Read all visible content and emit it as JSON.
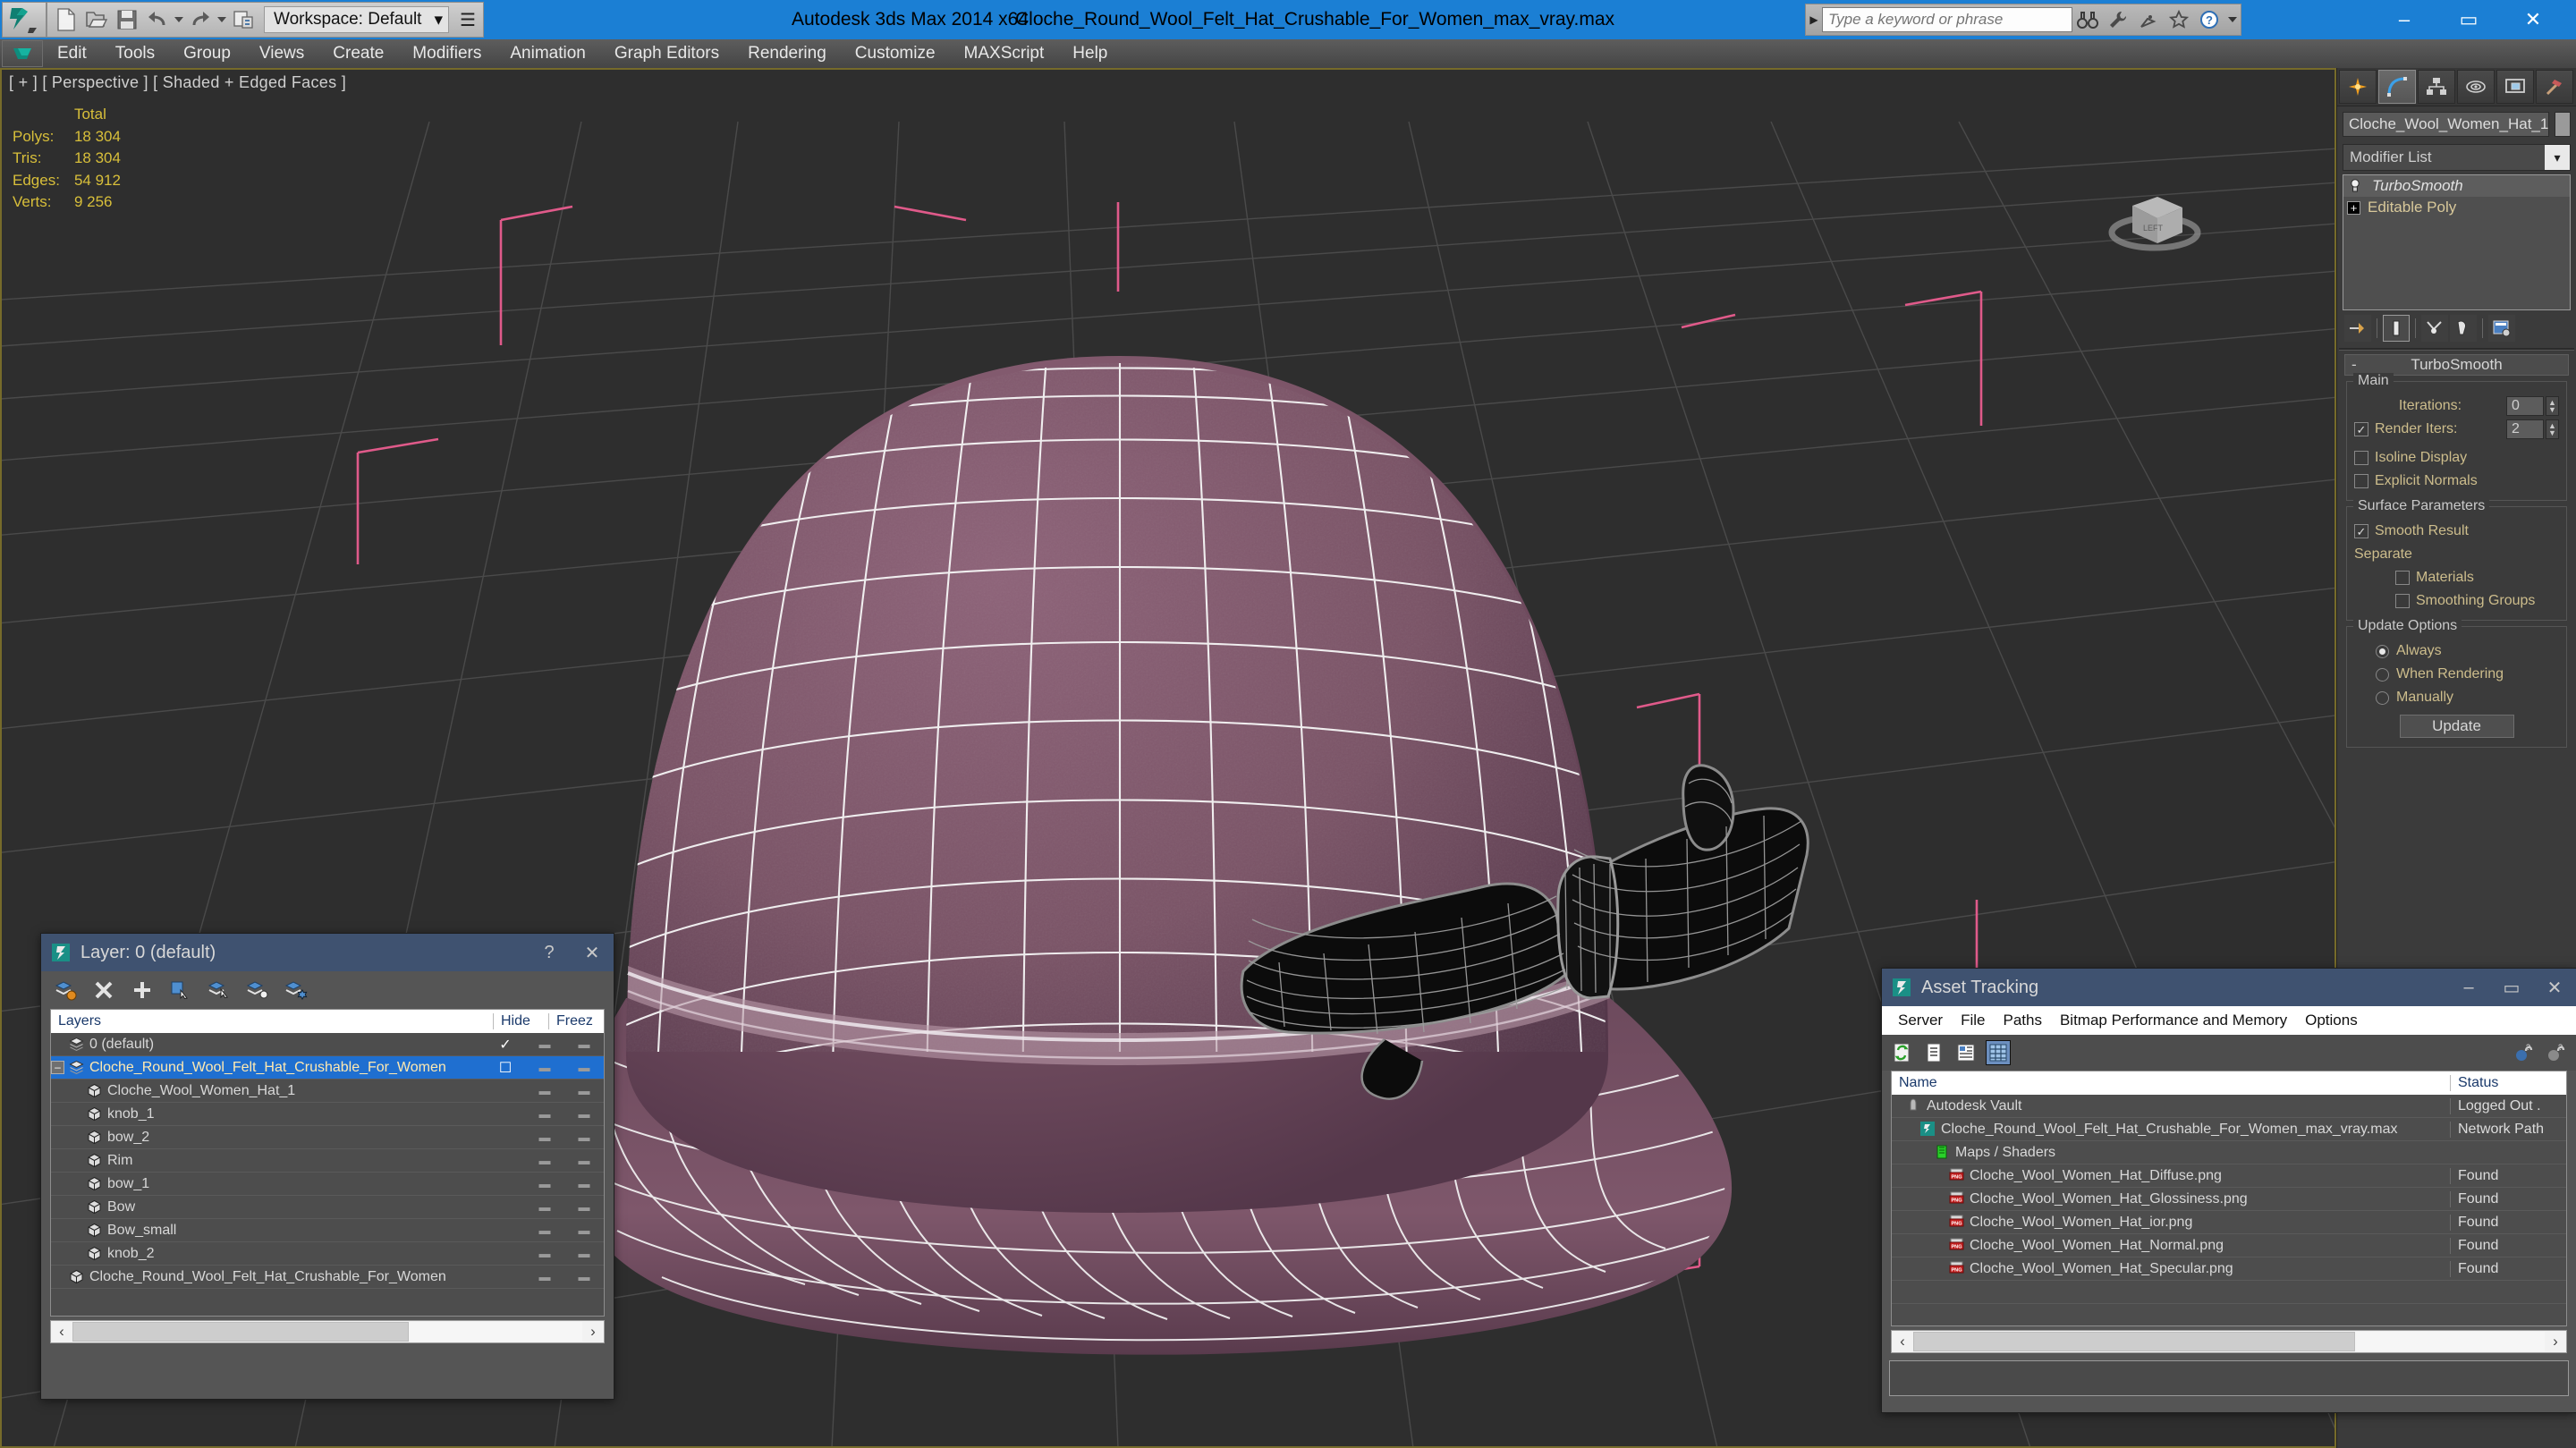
{
  "titlebar": {
    "app_title": "Autodesk 3ds Max  2014 x64",
    "file_title": "Cloche_Round_Wool_Felt_Hat_Crushable_For_Women_max_vray.max",
    "workspace_label": "Workspace: Default",
    "search_placeholder": "Type a keyword or phrase",
    "accent_color": "#1b7fd4",
    "quick_access": [
      {
        "name": "new-file-icon",
        "label": "New"
      },
      {
        "name": "open-file-icon",
        "label": "Open"
      },
      {
        "name": "save-file-icon",
        "label": "Save"
      },
      {
        "name": "undo-icon",
        "label": "Undo"
      },
      {
        "name": "redo-icon",
        "label": "Redo"
      },
      {
        "name": "set-project-folder-icon",
        "label": "Set Project Folder"
      }
    ],
    "help_icons": [
      {
        "name": "search-binoculars-icon",
        "label": "Search"
      },
      {
        "name": "wrench-icon",
        "label": "Tools"
      },
      {
        "name": "satellite-dish-icon",
        "label": "Subscription"
      },
      {
        "name": "star-icon",
        "label": "Favorites"
      },
      {
        "name": "help-question-icon",
        "label": "Help"
      }
    ],
    "window_controls": {
      "minimize": "–",
      "maximize": "▭",
      "close": "✕"
    }
  },
  "menubar": {
    "items": [
      "Edit",
      "Tools",
      "Group",
      "Views",
      "Create",
      "Modifiers",
      "Animation",
      "Graph Editors",
      "Rendering",
      "Customize",
      "MAXScript",
      "Help"
    ]
  },
  "viewport": {
    "label": "[ + ] [ Perspective ] [ Shaded + Edged Faces ]",
    "stats": {
      "header": "Total",
      "rows": [
        {
          "label": "Polys:",
          "value": "18 304"
        },
        {
          "label": "Tris:",
          "value": "18 304"
        },
        {
          "label": "Edges:",
          "value": "54 912"
        },
        {
          "label": "Verts:",
          "value": "9 256"
        }
      ]
    },
    "viewcube_face": "LEFT",
    "colors": {
      "background": "#2e2e2e",
      "grid": "#4a4a4a",
      "stats_text": "#d8bf3a",
      "active_border": "#766b2a",
      "hat_material": "#7a5366",
      "wireframe": "#f2f2f2",
      "bow_material": "#0a0a0a",
      "selection_bracket": "#e05a8a"
    }
  },
  "command_panel": {
    "tabs": [
      {
        "name": "create-tab",
        "label": "Create"
      },
      {
        "name": "modify-tab",
        "label": "Modify"
      },
      {
        "name": "hierarchy-tab",
        "label": "Hierarchy"
      },
      {
        "name": "motion-tab",
        "label": "Motion"
      },
      {
        "name": "display-tab",
        "label": "Display"
      },
      {
        "name": "utilities-tab",
        "label": "Utilities"
      }
    ],
    "selected_tab": "modify-tab",
    "object_name": "Cloche_Wool_Women_Hat_1",
    "modifier_list_label": "Modifier List",
    "stack": [
      {
        "label": "TurboSmooth",
        "active": true
      },
      {
        "label": "Editable Poly",
        "active": false
      }
    ],
    "stack_tools": [
      {
        "name": "pin-stack-icon",
        "label": "Pin Stack"
      },
      {
        "name": "show-end-result-icon",
        "label": "Show End Result",
        "selected": true
      },
      {
        "name": "make-unique-icon",
        "label": "Make Unique"
      },
      {
        "name": "remove-modifier-icon",
        "label": "Remove Modifier"
      },
      {
        "name": "configure-modifier-sets-icon",
        "label": "Configure Modifier Sets"
      }
    ],
    "rollout": {
      "title": "TurboSmooth",
      "collapse_glyph": "-",
      "main": {
        "title": "Main",
        "iterations_label": "Iterations:",
        "iterations_value": "0",
        "render_iters_label": "Render Iters:",
        "render_iters_value": "2",
        "render_iters_checked": true,
        "isoline_label": "Isoline Display",
        "isoline_checked": false,
        "explicit_normals_label": "Explicit Normals",
        "explicit_normals_checked": false
      },
      "surface": {
        "title": "Surface Parameters",
        "smooth_result_label": "Smooth Result",
        "smooth_result_checked": true,
        "separate_label": "Separate",
        "materials_label": "Materials",
        "materials_checked": false,
        "smoothing_groups_label": "Smoothing Groups",
        "smoothing_groups_checked": false
      },
      "update": {
        "title": "Update Options",
        "options": [
          {
            "label": "Always",
            "selected": true
          },
          {
            "label": "When Rendering",
            "selected": false
          },
          {
            "label": "Manually",
            "selected": false
          }
        ],
        "button_label": "Update"
      }
    }
  },
  "layer_window": {
    "title": "Layer: 0 (default)",
    "help_glyph": "?",
    "close_glyph": "✕",
    "tools": [
      {
        "name": "create-new-layer-icon",
        "label": "Create New Layer"
      },
      {
        "name": "delete-highlighted-layers-icon",
        "label": "Delete Highlighted Empty Layers"
      },
      {
        "name": "add-selection-to-layer-icon",
        "label": "Add Selection to Highlighted Layer"
      },
      {
        "name": "select-objects-in-layer-icon",
        "label": "Select Objects in Highlighted Layers"
      },
      {
        "name": "highlight-selected-objects-layer-icon",
        "label": "Highlight Selected Objects' Layers"
      },
      {
        "name": "set-current-layer-to-selection-icon",
        "label": "Set Current Layer to Selection's Layer"
      },
      {
        "name": "layer-properties-icon",
        "label": "Layer Properties"
      }
    ],
    "columns": [
      "Layers",
      "",
      "Hide",
      "Freez"
    ],
    "rows": [
      {
        "label": "0 (default)",
        "indent": 1,
        "type": "layer",
        "current": true,
        "selected": false,
        "expander": false
      },
      {
        "label": "Cloche_Round_Wool_Felt_Hat_Crushable_For_Women",
        "indent": 0,
        "type": "layer",
        "current": false,
        "selected": true,
        "expander": true
      },
      {
        "label": "Cloche_Wool_Women_Hat_1",
        "indent": 2,
        "type": "object",
        "current": false,
        "selected": false,
        "expander": false
      },
      {
        "label": "knob_1",
        "indent": 2,
        "type": "object",
        "current": false,
        "selected": false,
        "expander": false
      },
      {
        "label": "bow_2",
        "indent": 2,
        "type": "object",
        "current": false,
        "selected": false,
        "expander": false
      },
      {
        "label": "Rim",
        "indent": 2,
        "type": "object",
        "current": false,
        "selected": false,
        "expander": false
      },
      {
        "label": "bow_1",
        "indent": 2,
        "type": "object",
        "current": false,
        "selected": false,
        "expander": false
      },
      {
        "label": "Bow",
        "indent": 2,
        "type": "object",
        "current": false,
        "selected": false,
        "expander": false
      },
      {
        "label": "Bow_small",
        "indent": 2,
        "type": "object",
        "current": false,
        "selected": false,
        "expander": false
      },
      {
        "label": "knob_2",
        "indent": 2,
        "type": "object",
        "current": false,
        "selected": false,
        "expander": false
      },
      {
        "label": "Cloche_Round_Wool_Felt_Hat_Crushable_For_Women",
        "indent": 1,
        "type": "object",
        "current": false,
        "selected": false,
        "expander": false
      }
    ],
    "scroll_left_glyph": "‹",
    "scroll_right_glyph": "›"
  },
  "asset_tracking": {
    "title": "Asset Tracking",
    "window_controls": {
      "minimize": "–",
      "maximize": "▭",
      "close": "✕"
    },
    "menu": [
      "Server",
      "File",
      "Paths",
      "Bitmap Performance and Memory",
      "Options"
    ],
    "tools": [
      {
        "name": "refresh-icon",
        "label": "Refresh",
        "selected": false
      },
      {
        "name": "list-view-icon",
        "label": "List View",
        "selected": false
      },
      {
        "name": "detail-view-icon",
        "label": "Detail View",
        "selected": false
      },
      {
        "name": "grid-view-icon",
        "label": "Grid View",
        "selected": true
      }
    ],
    "right_tools": [
      {
        "name": "check-in-icon",
        "label": "Check In"
      },
      {
        "name": "check-out-icon",
        "label": "Check Out"
      }
    ],
    "columns": [
      "Name",
      "Status"
    ],
    "rows": [
      {
        "name": "Autodesk Vault",
        "status": "Logged Out .",
        "indent": 1,
        "icon": "vault-icon"
      },
      {
        "name": "Cloche_Round_Wool_Felt_Hat_Crushable_For_Women_max_vray.max",
        "status": "Network Path",
        "indent": 2,
        "icon": "max-file-icon"
      },
      {
        "name": "Maps / Shaders",
        "status": "",
        "indent": 3,
        "icon": "maps-shaders-icon"
      },
      {
        "name": "Cloche_Wool_Women_Hat_Diffuse.png",
        "status": "Found",
        "indent": 4,
        "icon": "png-icon"
      },
      {
        "name": "Cloche_Wool_Women_Hat_Glossiness.png",
        "status": "Found",
        "indent": 4,
        "icon": "png-icon"
      },
      {
        "name": "Cloche_Wool_Women_Hat_ior.png",
        "status": "Found",
        "indent": 4,
        "icon": "png-icon"
      },
      {
        "name": "Cloche_Wool_Women_Hat_Normal.png",
        "status": "Found",
        "indent": 4,
        "icon": "png-icon"
      },
      {
        "name": "Cloche_Wool_Women_Hat_Specular.png",
        "status": "Found",
        "indent": 4,
        "icon": "png-icon"
      },
      {
        "name": "",
        "status": "",
        "indent": 0,
        "icon": ""
      },
      {
        "name": "",
        "status": "",
        "indent": 0,
        "icon": ""
      }
    ],
    "scroll_left_glyph": "‹",
    "scroll_right_glyph": "›"
  }
}
